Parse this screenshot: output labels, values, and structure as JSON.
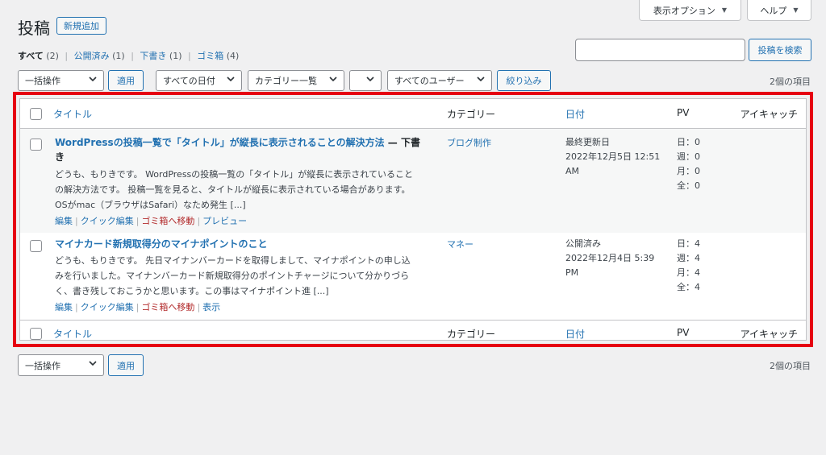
{
  "screen_options": "表示オプション",
  "help": "ヘルプ",
  "page_title": "投稿",
  "add_new": "新規追加",
  "views": {
    "all": {
      "label": "すべて",
      "count": "(2)"
    },
    "publish": {
      "label": "公開済み",
      "count": "(1)"
    },
    "draft": {
      "label": "下書き",
      "count": "(1)"
    },
    "trash": {
      "label": "ゴミ箱",
      "count": "(4)"
    }
  },
  "search": {
    "value": "",
    "button": "投稿を検索"
  },
  "filters": {
    "bulk_action": "一括操作",
    "apply": "適用",
    "all_dates": "すべての日付",
    "categories": "カテゴリー一覧",
    "extra": "",
    "all_users": "すべてのユーザー",
    "filter": "絞り込み"
  },
  "item_count": "2個の項目",
  "columns": {
    "title": "タイトル",
    "category": "カテゴリー",
    "date": "日付",
    "pv": "PV",
    "thumbnail": "アイキャッチ"
  },
  "posts": [
    {
      "title_line1": "WordPressの投稿一覧で「タイトル」が縦長に表示されることの解決方法",
      "state": " — 下書",
      "title_line2": "き",
      "excerpt": [
        "どうも、もりきです。 WordPressの投稿一覧の「タイトル」が縦長に表示されていること",
        "の解決方法です。 投稿一覧を見ると、タイトルが縦長に表示されている場合があります。",
        "OSがmac（ブラウザはSafari）なため発生 [...]"
      ],
      "actions": {
        "edit": "編集",
        "quick_edit": "クイック編集",
        "trash": "ゴミ箱へ移動",
        "view": "プレビュー"
      },
      "category": "ブログ制作",
      "date": [
        "最終更新日",
        "2022年12月5日 12:51",
        "AM"
      ],
      "pv": [
        "日：0",
        "週：0",
        "月：0",
        "全：0"
      ]
    },
    {
      "title_line1": "マイナカード新規取得分のマイナポイントのこと",
      "state": "",
      "title_line2": "",
      "excerpt": [
        "どうも、もりきです。 先日マイナンバーカードを取得しまして、マイナポイントの申し込",
        "みを行いました。マイナンバーカード新規取得分のポイントチャージについて分かりづら",
        "く、書き残しておこうかと思います。この事はマイナポイント進 [...]"
      ],
      "actions": {
        "edit": "編集",
        "quick_edit": "クイック編集",
        "trash": "ゴミ箱へ移動",
        "view": "表示"
      },
      "category": "マネー",
      "date": [
        "公開済み",
        "2022年12月4日 5:39",
        "PM"
      ],
      "pv": [
        "日：4",
        "週：4",
        "月：4",
        "全：4"
      ]
    }
  ],
  "colors": {
    "accent": "#2271b1",
    "highlight_border": "#e60012",
    "trash": "#b32d2e"
  }
}
